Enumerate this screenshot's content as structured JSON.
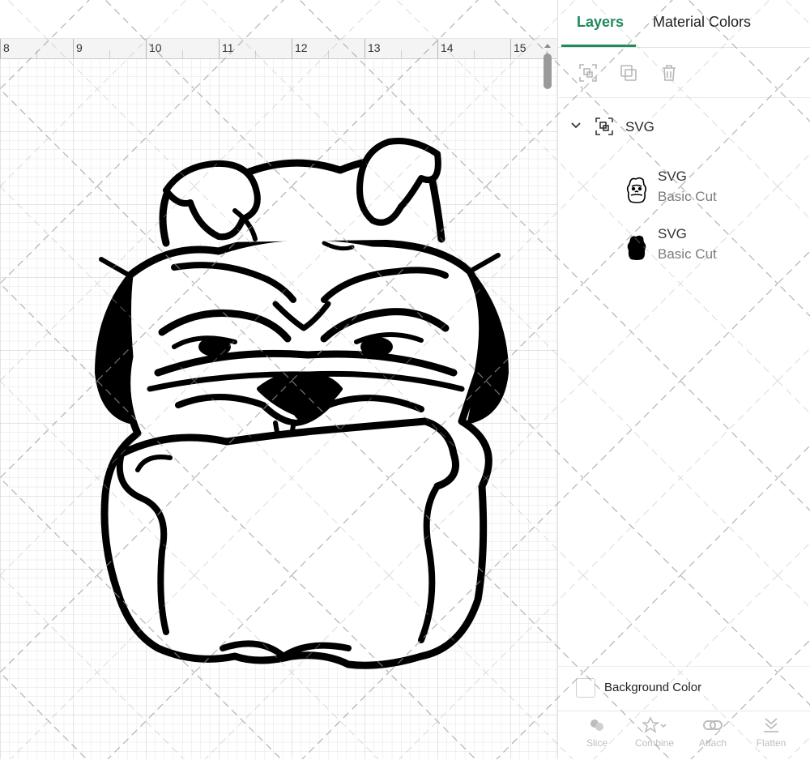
{
  "ruler": {
    "ticks": [
      "8",
      "9",
      "10",
      "11",
      "12",
      "13",
      "14",
      "15"
    ]
  },
  "panel": {
    "tabs": {
      "layers": "Layers",
      "material": "Material Colors"
    },
    "group": {
      "label": "SVG"
    },
    "layers": [
      {
        "name": "SVG",
        "op": "Basic Cut"
      },
      {
        "name": "SVG",
        "op": "Basic Cut"
      }
    ],
    "background": {
      "label": "Background Color"
    },
    "bottom": {
      "slice": "Slice",
      "combine": "Combine",
      "attach": "Attach",
      "flatten": "Flatten"
    }
  },
  "colors": {
    "accent": "#1f8a5b",
    "ink": "#000000",
    "grid": "#d8d8d8"
  },
  "icons": [
    "group-icon",
    "ungroup-icon",
    "duplicate-icon",
    "delete-icon",
    "chevron-down-icon",
    "slice-icon",
    "combine-icon",
    "attach-icon",
    "flatten-icon"
  ]
}
